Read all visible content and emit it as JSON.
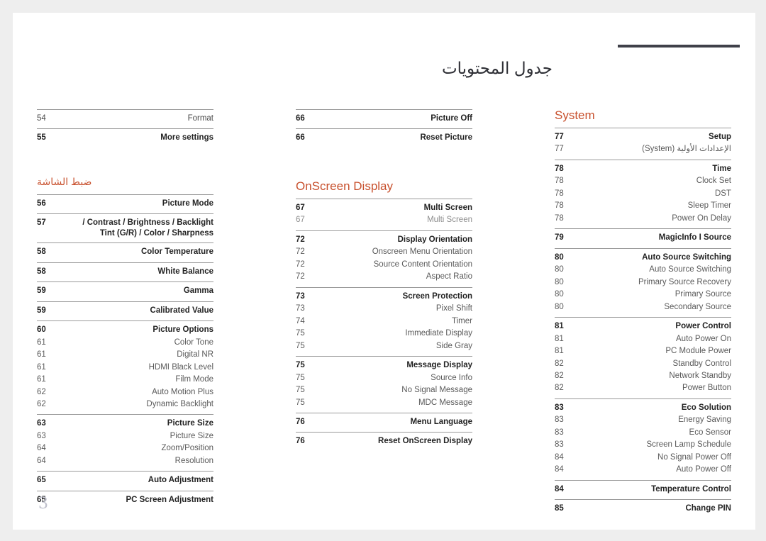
{
  "document": {
    "title": "جدول المحتويات",
    "folio": "3"
  },
  "columns": [
    {
      "id": "column-left",
      "blocks": [
        {
          "type": "section-heading",
          "label": "System",
          "script": "latin"
        },
        {
          "type": "group",
          "rows": [
            {
              "page": "77",
              "label": "Setup",
              "level": "main"
            },
            {
              "page": "77",
              "label": "الإعدادات الأولية (System)",
              "level": "sub",
              "script": "arabic"
            }
          ]
        },
        {
          "type": "group",
          "rows": [
            {
              "page": "78",
              "label": "Time",
              "level": "main"
            },
            {
              "page": "78",
              "label": "Clock Set",
              "level": "sub"
            },
            {
              "page": "78",
              "label": "DST",
              "level": "sub"
            },
            {
              "page": "78",
              "label": "Sleep Timer",
              "level": "sub"
            },
            {
              "page": "78",
              "label": "Power On Delay",
              "level": "sub"
            }
          ]
        },
        {
          "type": "group",
          "rows": [
            {
              "page": "79",
              "label": "MagicInfo I Source",
              "level": "main"
            }
          ]
        },
        {
          "type": "group",
          "rows": [
            {
              "page": "80",
              "label": "Auto Source Switching",
              "level": "main"
            },
            {
              "page": "80",
              "label": "Auto Source Switching",
              "level": "sub"
            },
            {
              "page": "80",
              "label": "Primary Source Recovery",
              "level": "sub"
            },
            {
              "page": "80",
              "label": "Primary Source",
              "level": "sub"
            },
            {
              "page": "80",
              "label": "Secondary Source",
              "level": "sub"
            }
          ]
        },
        {
          "type": "group",
          "rows": [
            {
              "page": "81",
              "label": "Power Control",
              "level": "main"
            },
            {
              "page": "81",
              "label": "Auto Power On",
              "level": "sub"
            },
            {
              "page": "81",
              "label": "PC Module Power",
              "level": "sub"
            },
            {
              "page": "82",
              "label": "Standby Control",
              "level": "sub"
            },
            {
              "page": "82",
              "label": "Network Standby",
              "level": "sub"
            },
            {
              "page": "82",
              "label": "Power Button",
              "level": "sub"
            }
          ]
        },
        {
          "type": "group",
          "rows": [
            {
              "page": "83",
              "label": "Eco Solution",
              "level": "main"
            },
            {
              "page": "83",
              "label": "Energy Saving",
              "level": "sub"
            },
            {
              "page": "83",
              "label": "Eco Sensor",
              "level": "sub"
            },
            {
              "page": "83",
              "label": "Screen Lamp Schedule",
              "level": "sub"
            },
            {
              "page": "84",
              "label": "No Signal Power Off",
              "level": "sub"
            },
            {
              "page": "84",
              "label": "Auto Power Off",
              "level": "sub"
            }
          ]
        },
        {
          "type": "group",
          "rows": [
            {
              "page": "84",
              "label": "Temperature Control",
              "level": "main"
            }
          ]
        },
        {
          "type": "group",
          "rows": [
            {
              "page": "85",
              "label": "Change PIN",
              "level": "main"
            }
          ]
        }
      ]
    },
    {
      "id": "column-middle",
      "blocks": [
        {
          "type": "group",
          "rows": [
            {
              "page": "66",
              "label": "Picture Off",
              "level": "main"
            }
          ]
        },
        {
          "type": "group",
          "rows": [
            {
              "page": "66",
              "label": "Reset Picture",
              "level": "main"
            }
          ]
        },
        {
          "type": "spacer",
          "size": "large"
        },
        {
          "type": "section-heading",
          "label": "OnScreen Display",
          "script": "latin"
        },
        {
          "type": "group",
          "rows": [
            {
              "page": "67",
              "label": "Multi Screen",
              "level": "main"
            },
            {
              "page": "67",
              "label": "Multi Screen",
              "level": "faint"
            }
          ]
        },
        {
          "type": "group",
          "rows": [
            {
              "page": "72",
              "label": "Display Orientation",
              "level": "main"
            },
            {
              "page": "72",
              "label": "Onscreen Menu Orientation",
              "level": "sub"
            },
            {
              "page": "72",
              "label": "Source Content Orientation",
              "level": "sub"
            },
            {
              "page": "72",
              "label": "Aspect Ratio",
              "level": "sub"
            }
          ]
        },
        {
          "type": "group",
          "rows": [
            {
              "page": "73",
              "label": "Screen Protection",
              "level": "main"
            },
            {
              "page": "73",
              "label": "Pixel Shift",
              "level": "sub"
            },
            {
              "page": "74",
              "label": "Timer",
              "level": "sub"
            },
            {
              "page": "75",
              "label": "Immediate Display",
              "level": "sub"
            },
            {
              "page": "75",
              "label": "Side Gray",
              "level": "sub"
            }
          ]
        },
        {
          "type": "group",
          "rows": [
            {
              "page": "75",
              "label": "Message Display",
              "level": "main"
            },
            {
              "page": "75",
              "label": "Source Info",
              "level": "sub"
            },
            {
              "page": "75",
              "label": "No Signal Message",
              "level": "sub"
            },
            {
              "page": "75",
              "label": "MDC Message",
              "level": "sub"
            }
          ]
        },
        {
          "type": "group",
          "rows": [
            {
              "page": "76",
              "label": "Menu Language",
              "level": "main"
            }
          ]
        },
        {
          "type": "group",
          "rows": [
            {
              "page": "76",
              "label": "Reset OnScreen Display",
              "level": "main"
            }
          ]
        }
      ]
    },
    {
      "id": "column-right",
      "blocks": [
        {
          "type": "group",
          "rows": [
            {
              "page": "54",
              "label": "Format",
              "level": "plain"
            }
          ]
        },
        {
          "type": "group",
          "rows": [
            {
              "page": "55",
              "label": "More settings",
              "level": "main"
            }
          ]
        },
        {
          "type": "spacer",
          "size": "medium"
        },
        {
          "type": "section-heading",
          "label": "ضبط الشاشة",
          "script": "arabic"
        },
        {
          "type": "group",
          "rows": [
            {
              "page": "56",
              "label": "Picture Mode",
              "level": "main"
            }
          ]
        },
        {
          "type": "group",
          "rows": [
            {
              "page": "57",
              "label": "/ Contrast / Brightness / Backlight\nTint (G/R) / Color / Sharpness",
              "level": "main",
              "lines": 2
            }
          ]
        },
        {
          "type": "group",
          "rows": [
            {
              "page": "58",
              "label": "Color Temperature",
              "level": "main"
            }
          ]
        },
        {
          "type": "group",
          "rows": [
            {
              "page": "58",
              "label": "White Balance",
              "level": "main"
            }
          ]
        },
        {
          "type": "group",
          "rows": [
            {
              "page": "59",
              "label": "Gamma",
              "level": "main"
            }
          ]
        },
        {
          "type": "group",
          "rows": [
            {
              "page": "59",
              "label": "Calibrated Value",
              "level": "main"
            }
          ]
        },
        {
          "type": "group",
          "rows": [
            {
              "page": "60",
              "label": "Picture Options",
              "level": "main"
            },
            {
              "page": "61",
              "label": "Color Tone",
              "level": "sub"
            },
            {
              "page": "61",
              "label": "Digital NR",
              "level": "sub"
            },
            {
              "page": "61",
              "label": "HDMI Black Level",
              "level": "sub"
            },
            {
              "page": "61",
              "label": "Film Mode",
              "level": "sub"
            },
            {
              "page": "62",
              "label": "Auto Motion Plus",
              "level": "sub"
            },
            {
              "page": "62",
              "label": "Dynamic Backlight",
              "level": "sub"
            }
          ]
        },
        {
          "type": "group",
          "rows": [
            {
              "page": "63",
              "label": "Picture Size",
              "level": "main"
            },
            {
              "page": "63",
              "label": "Picture Size",
              "level": "sub"
            },
            {
              "page": "64",
              "label": "Zoom/Position",
              "level": "sub"
            },
            {
              "page": "64",
              "label": "Resolution",
              "level": "sub"
            }
          ]
        },
        {
          "type": "group",
          "rows": [
            {
              "page": "65",
              "label": "Auto Adjustment",
              "level": "main"
            }
          ]
        },
        {
          "type": "group",
          "rows": [
            {
              "page": "65",
              "label": "PC Screen Adjustment",
              "level": "main"
            }
          ]
        }
      ]
    }
  ],
  "colors": {
    "accent": "#c8512e",
    "title_rule": "#3f4049",
    "folio": "#bfc0cc",
    "page_background": "#ffffff",
    "canvas": "#eeeeee"
  }
}
